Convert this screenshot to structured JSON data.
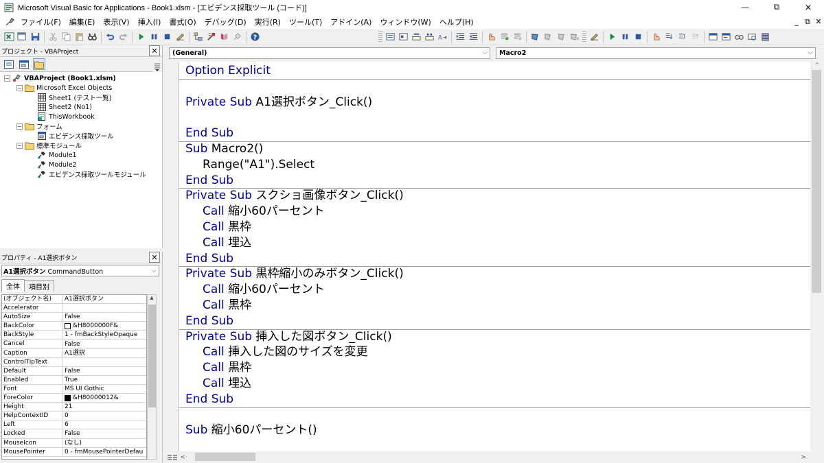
{
  "titlebar": {
    "title": "Microsoft Visual Basic for Applications - Book1.xlsm - [エビデンス採取ツール (コード)]",
    "minimize": "—",
    "restore": "⧉",
    "close": "✕"
  },
  "menubar": {
    "items": [
      "ファイル(F)",
      "編集(E)",
      "表示(V)",
      "挿入(I)",
      "書式(O)",
      "デバッグ(D)",
      "実行(R)",
      "ツール(T)",
      "アドイン(A)",
      "ウィンドウ(W)",
      "ヘルプ(H)"
    ],
    "mdi_min": "_",
    "mdi_restore": "⧉",
    "mdi_close": "✕"
  },
  "project": {
    "header": "プロジェクト - VBAProject",
    "close": "✕",
    "tree": [
      {
        "label": "VBAProject (Book1.xlsm)",
        "level": 0,
        "icon": "vbaproject-icon",
        "exp": "−"
      },
      {
        "label": "Microsoft Excel Objects",
        "level": 1,
        "icon": "folder-icon",
        "exp": "−"
      },
      {
        "label": "Sheet1 (テスト一覧)",
        "level": 2,
        "icon": "sheet-icon",
        "exp": ""
      },
      {
        "label": "Sheet2 (No1)",
        "level": 2,
        "icon": "sheet-icon",
        "exp": ""
      },
      {
        "label": "ThisWorkbook",
        "level": 2,
        "icon": "workbook-icon",
        "exp": ""
      },
      {
        "label": "フォーム",
        "level": 1,
        "icon": "folder-icon",
        "exp": "−"
      },
      {
        "label": "エビデンス採取ツール",
        "level": 2,
        "icon": "form-icon",
        "exp": ""
      },
      {
        "label": "標準モジュール",
        "level": 1,
        "icon": "folder-icon",
        "exp": "−"
      },
      {
        "label": "Module1",
        "level": 2,
        "icon": "module-icon",
        "exp": ""
      },
      {
        "label": "Module2",
        "level": 2,
        "icon": "module-icon",
        "exp": ""
      },
      {
        "label": "エビデンス採取ツールモジュール",
        "level": 2,
        "icon": "module-icon",
        "exp": ""
      }
    ]
  },
  "properties": {
    "header": "プロパティ - A1選択ボタン",
    "close": "✕",
    "object_name": "A1選択ボタン",
    "object_type": "CommandButton",
    "tabs": [
      "全体",
      "項目別"
    ],
    "rows": [
      {
        "name": "(オブジェクト名)",
        "value": "A1選択ボタン"
      },
      {
        "name": "Accelerator",
        "value": ""
      },
      {
        "name": "AutoSize",
        "value": "False"
      },
      {
        "name": "BackColor",
        "value": "&H8000000F&",
        "swatch": "#ffffff"
      },
      {
        "name": "BackStyle",
        "value": "1 - fmBackStyleOpaque"
      },
      {
        "name": "Cancel",
        "value": "False"
      },
      {
        "name": "Caption",
        "value": "A1選択"
      },
      {
        "name": "ControlTipText",
        "value": ""
      },
      {
        "name": "Default",
        "value": "False"
      },
      {
        "name": "Enabled",
        "value": "True"
      },
      {
        "name": "Font",
        "value": "MS UI Gothic"
      },
      {
        "name": "ForeColor",
        "value": "&H80000012&",
        "swatch": "#000000"
      },
      {
        "name": "Height",
        "value": "21"
      },
      {
        "name": "HelpContextID",
        "value": "0"
      },
      {
        "name": "Left",
        "value": "6"
      },
      {
        "name": "Locked",
        "value": "False"
      },
      {
        "name": "MouseIcon",
        "value": "(なし)"
      },
      {
        "name": "MousePointer",
        "value": "0 - fmMousePointerDefau"
      }
    ]
  },
  "code": {
    "object_combo": "(General)",
    "proc_combo": "Macro2",
    "lines": [
      {
        "kw": "Option Explicit",
        "rest": "",
        "indent": 0,
        "sep_after": true
      },
      {
        "kw": "",
        "rest": "",
        "indent": 0
      },
      {
        "kw": "Private Sub",
        "rest": " A1選択ボタン_Click()",
        "indent": 0
      },
      {
        "kw": "",
        "rest": "",
        "indent": 0
      },
      {
        "kw": "End Sub",
        "rest": "",
        "indent": 0,
        "sep_after": true
      },
      {
        "kw": "Sub",
        "rest": " Macro2()",
        "indent": 0
      },
      {
        "kw": "",
        "rest": "Range(\"A1\").Select",
        "indent": 1
      },
      {
        "kw": "End Sub",
        "rest": "",
        "indent": 0,
        "sep_after": true
      },
      {
        "kw": "Private Sub",
        "rest": " スクショ画像ボタン_Click()",
        "indent": 0
      },
      {
        "kw": "Call",
        "rest": " 縮小60パーセント",
        "indent": 1
      },
      {
        "kw": "Call",
        "rest": " 黒枠",
        "indent": 1
      },
      {
        "kw": "Call",
        "rest": " 埋込",
        "indent": 1
      },
      {
        "kw": "End Sub",
        "rest": "",
        "indent": 0,
        "sep_after": true
      },
      {
        "kw": "Private Sub",
        "rest": " 黒枠縮小のみボタン_Click()",
        "indent": 0
      },
      {
        "kw": "Call",
        "rest": " 縮小60パーセント",
        "indent": 1
      },
      {
        "kw": "Call",
        "rest": " 黒枠",
        "indent": 1
      },
      {
        "kw": "End Sub",
        "rest": "",
        "indent": 0,
        "sep_after": true
      },
      {
        "kw": "Private Sub",
        "rest": " 挿入した図ボタン_Click()",
        "indent": 0
      },
      {
        "kw": "Call",
        "rest": " 挿入した図のサイズを変更",
        "indent": 1
      },
      {
        "kw": "Call",
        "rest": " 黒枠",
        "indent": 1
      },
      {
        "kw": "Call",
        "rest": " 埋込",
        "indent": 1
      },
      {
        "kw": "End Sub",
        "rest": "",
        "indent": 0,
        "sep_after": true
      },
      {
        "kw": "",
        "rest": "",
        "indent": 0
      },
      {
        "kw": "Sub",
        "rest": " 縮小60パーセント()",
        "indent": 0
      }
    ]
  },
  "colors": {
    "keyword": "#0000a0",
    "text": "#000000"
  }
}
